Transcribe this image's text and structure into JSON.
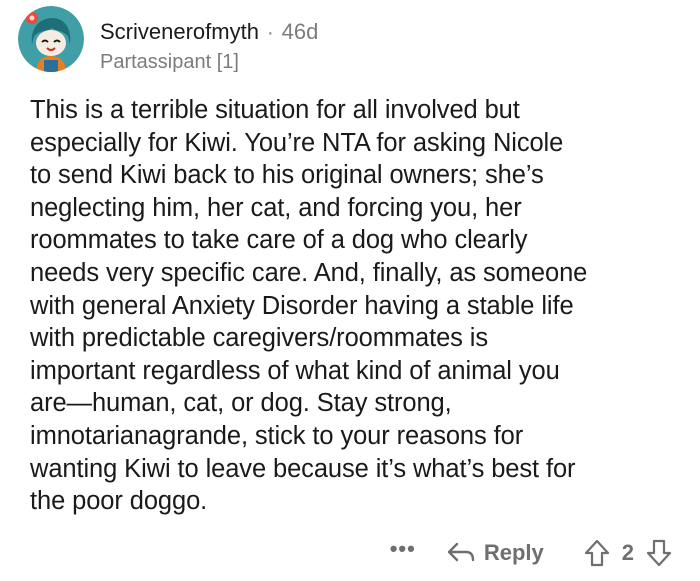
{
  "comment": {
    "username": "Scrivenerofmyth",
    "separator": "·",
    "age": "46d",
    "flair": "Partassipant [1]",
    "body": "This is a terrible situation for all involved but\nespecially for Kiwi. You’re NTA for asking Nicole\nto send Kiwi back to his original owners; she’s\nneglecting him, her cat, and forcing you, her\nroommates to take care of a dog who clearly\nneeds very specific care. And, finally, as someone\nwith general Anxiety Disorder having a stable life\nwith predictable caregivers/roommates is\nimportant regardless of what kind of animal you\nare—human, cat, or dog. Stay strong,\nimnotarianagrande, stick to your reasons for\nwanting Kiwi to leave because it’s what’s best for\nthe poor doggo."
  },
  "actions": {
    "more": "•••",
    "reply_label": "Reply",
    "score": "2"
  },
  "icons": {
    "avatar": "avatar-icon",
    "more": "more-options-icon",
    "reply": "reply-arrow-icon",
    "upvote": "upvote-arrow-icon",
    "downvote": "downvote-arrow-icon"
  },
  "colors": {
    "text": "#1a1a1b",
    "meta": "#7c7c7c",
    "avatar_bg": "#3f9ea6"
  }
}
